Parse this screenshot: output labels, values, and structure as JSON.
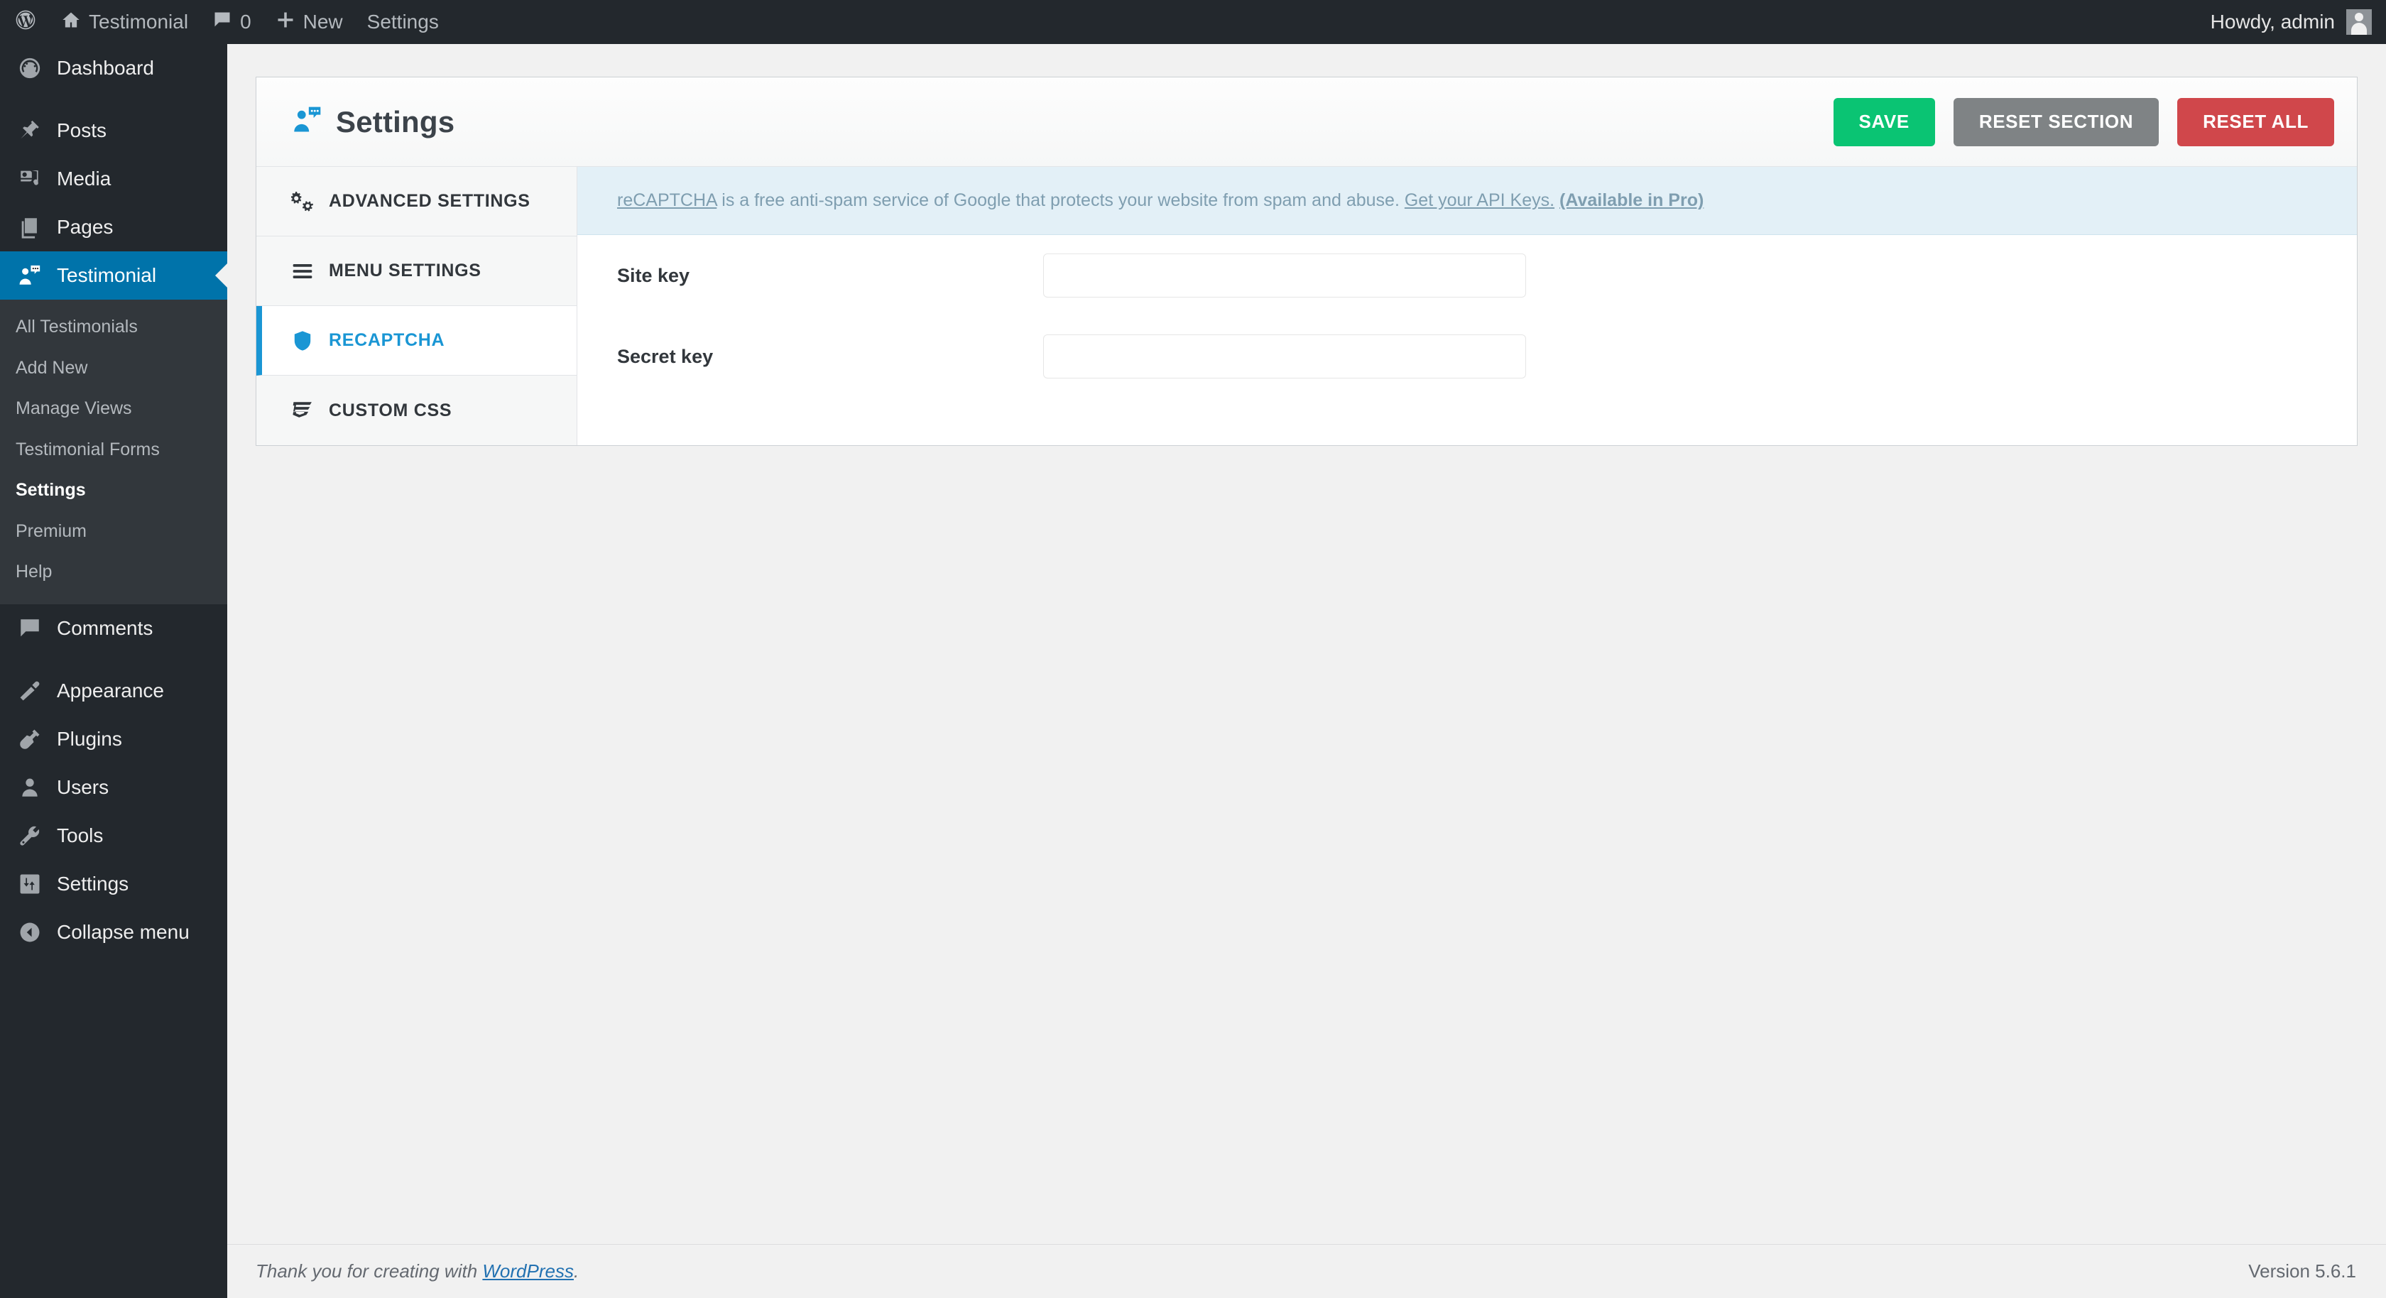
{
  "adminbar": {
    "wp_logo_icon": "wordpress-logo-icon",
    "site_icon": "home-icon",
    "site_name": "Testimonial",
    "comments_icon": "comment-bubble-icon",
    "comments_count": "0",
    "new_icon": "plus-icon",
    "new_label": "New",
    "settings_label": "Settings",
    "howdy": "Howdy, admin",
    "avatar_icon": "user-avatar-icon"
  },
  "sidebar": {
    "items": [
      {
        "label": "Dashboard",
        "icon": "dashboard-gauge-icon",
        "active": false
      },
      {
        "label": "Posts",
        "icon": "pushpin-icon",
        "active": false
      },
      {
        "label": "Media",
        "icon": "media-camera-music-icon",
        "active": false
      },
      {
        "label": "Pages",
        "icon": "pages-stack-icon",
        "active": false
      },
      {
        "label": "Testimonial",
        "icon": "testimonial-person-bubble-icon",
        "active": true
      },
      {
        "label": "Comments",
        "icon": "comment-bubble-icon",
        "active": false
      },
      {
        "label": "Appearance",
        "icon": "paintbrush-icon",
        "active": false
      },
      {
        "label": "Plugins",
        "icon": "plug-icon",
        "active": false
      },
      {
        "label": "Users",
        "icon": "user-icon",
        "active": false
      },
      {
        "label": "Tools",
        "icon": "wrench-icon",
        "active": false
      },
      {
        "label": "Settings",
        "icon": "sliders-icon",
        "active": false
      },
      {
        "label": "Collapse menu",
        "icon": "collapse-arrow-icon",
        "active": false
      }
    ],
    "submenu": [
      {
        "label": "All Testimonials",
        "current": false
      },
      {
        "label": "Add New",
        "current": false
      },
      {
        "label": "Manage Views",
        "current": false
      },
      {
        "label": "Testimonial Forms",
        "current": false
      },
      {
        "label": "Settings",
        "current": true
      },
      {
        "label": "Premium",
        "current": false
      },
      {
        "label": "Help",
        "current": false
      }
    ]
  },
  "page": {
    "title": "Settings",
    "title_icon": "testimonial-person-bubble-icon",
    "buttons": {
      "save": "SAVE",
      "reset_section": "RESET SECTION",
      "reset_all": "RESET ALL"
    }
  },
  "tabs": [
    {
      "label": "ADVANCED SETTINGS",
      "icon": "gears-icon",
      "active": false
    },
    {
      "label": "MENU SETTINGS",
      "icon": "hamburger-menu-icon",
      "active": false
    },
    {
      "label": "RECAPTCHA",
      "icon": "shield-icon",
      "active": true
    },
    {
      "label": "CUSTOM CSS",
      "icon": "css3-logo-icon",
      "active": false
    }
  ],
  "notice": {
    "link_recaptcha": "reCAPTCHA",
    "text_middle": " is a free anti-spam service of Google that protects your website from spam and abuse. ",
    "link_api_keys": "Get your API Keys.",
    "separator": " ",
    "link_pro": "(Available in Pro)"
  },
  "fields": [
    {
      "label": "Site key",
      "value": "",
      "placeholder": ""
    },
    {
      "label": "Secret key",
      "value": "",
      "placeholder": ""
    }
  ],
  "footer": {
    "thanks_prefix": "Thank you for creating with ",
    "wordpress_link": "WordPress",
    "thanks_suffix": ".",
    "version": "Version 5.6.1"
  },
  "colors": {
    "admin_dark": "#23282d",
    "submenu_dark": "#32373c",
    "active_blue": "#0073aa",
    "accent_blue": "#1a96d4",
    "save_green": "#0ac473",
    "reset_gray": "#7f8385",
    "reset_red": "#d0474b",
    "notice_bg": "#e3f0f7"
  }
}
